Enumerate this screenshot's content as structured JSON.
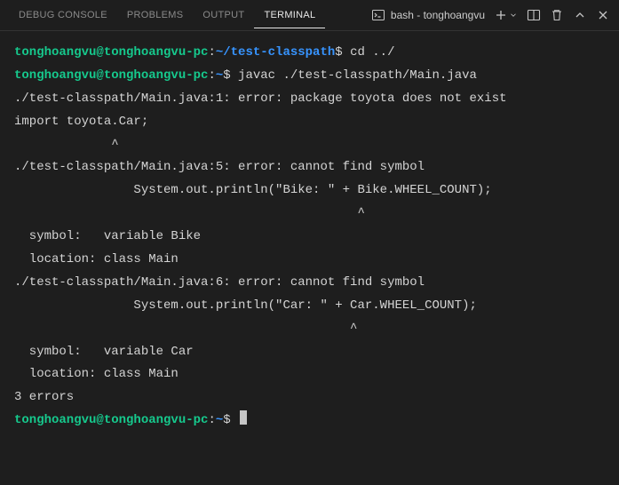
{
  "header": {
    "tabs": [
      {
        "label": "DEBUG CONSOLE",
        "active": false
      },
      {
        "label": "PROBLEMS",
        "active": false
      },
      {
        "label": "OUTPUT",
        "active": false
      },
      {
        "label": "TERMINAL",
        "active": true
      }
    ],
    "shell": "bash - tonghoangvu"
  },
  "terminal": {
    "prompt1": {
      "user": "tonghoangvu@tonghoangvu-pc",
      "colon": ":",
      "path": "~/test-classpath",
      "sym": "$",
      "cmd": " cd ../"
    },
    "prompt2": {
      "user": "tonghoangvu@tonghoangvu-pc",
      "colon": ":",
      "path": "~",
      "sym": "$",
      "cmd": " javac ./test-classpath/Main.java"
    },
    "out1": "./test-classpath/Main.java:1: error: package toyota does not exist",
    "out2": "import toyota.Car;",
    "out3": "             ^",
    "out4": "./test-classpath/Main.java:5: error: cannot find symbol",
    "out5": "                System.out.println(\"Bike: \" + Bike.WHEEL_COUNT);",
    "out6": "                                              ^",
    "out7": "  symbol:   variable Bike",
    "out8": "  location: class Main",
    "out9": "./test-classpath/Main.java:6: error: cannot find symbol",
    "out10": "                System.out.println(\"Car: \" + Car.WHEEL_COUNT);",
    "out11": "                                             ^",
    "out12": "  symbol:   variable Car",
    "out13": "  location: class Main",
    "out14": "3 errors",
    "prompt3": {
      "user": "tonghoangvu@tonghoangvu-pc",
      "colon": ":",
      "path": "~",
      "sym": "$",
      "cmd": " "
    }
  }
}
